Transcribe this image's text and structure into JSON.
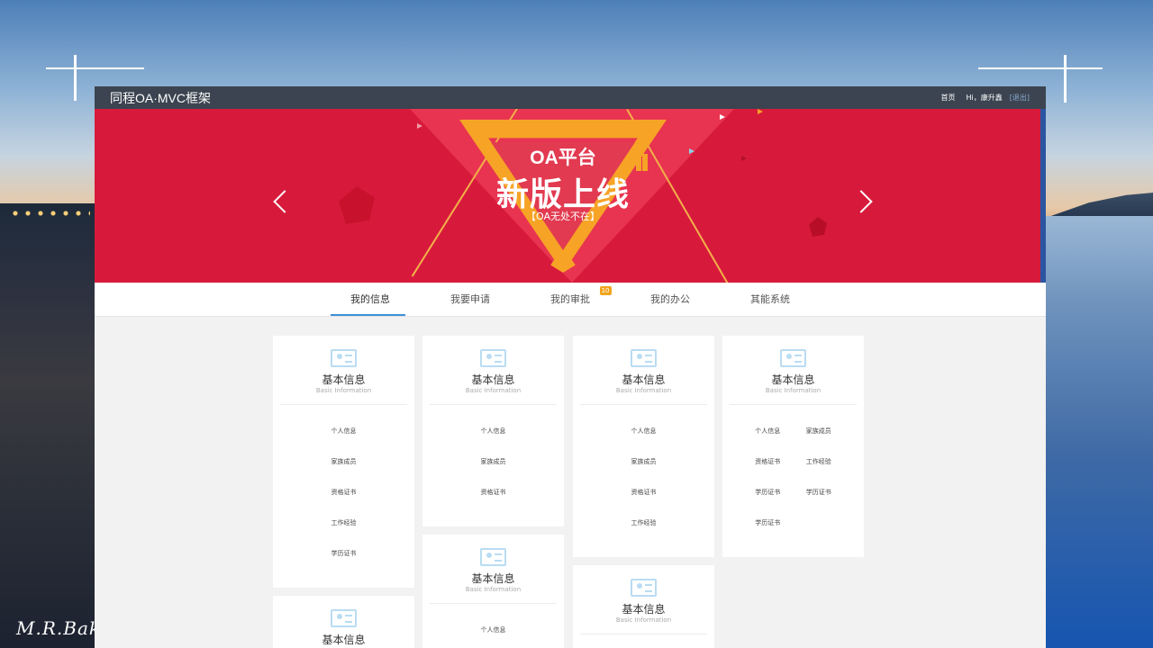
{
  "app": {
    "title": "同程OA·MVC框架"
  },
  "topbar": {
    "home": "首页",
    "greeting": "Hi，康升鑫",
    "logout": "[退出]"
  },
  "banner": {
    "line1": "OA平台",
    "line2": "新版上线",
    "line3": "【OA无处不在】",
    "slides": 3,
    "active_slide": 1
  },
  "tabs": [
    {
      "label": "我的信息",
      "active": true
    },
    {
      "label": "我要申请"
    },
    {
      "label": "我的审批",
      "badge": "10"
    },
    {
      "label": "我的办公"
    },
    {
      "label": "其能系统"
    }
  ],
  "cards": [
    {
      "title": "基本信息",
      "subtitle": "Basic Information",
      "links": [
        "个人信息",
        "家族成员",
        "资格证书",
        "工作经验",
        "学历证书"
      ]
    },
    {
      "title": "基本信息",
      "subtitle": "Basic Information",
      "links": [
        "个人信息",
        "家族成员",
        "资格证书"
      ]
    },
    {
      "title": "基本信息",
      "subtitle": "Basic Information",
      "links": [
        "个人信息",
        "家族成员",
        "资格证书",
        "工作经验"
      ]
    },
    {
      "title": "基本信息",
      "subtitle": "Basic Information",
      "links": [
        "个人信息",
        "家族成员",
        "资格证书",
        "工作经验",
        "学历证书",
        "学历证书",
        "学历证书"
      ]
    },
    {
      "title": "基本信息",
      "subtitle": "Basic Information",
      "links": [
        "个人信息"
      ]
    },
    {
      "title": "基本信息",
      "subtitle": "Basic Information",
      "links": []
    },
    {
      "title": "基本信息",
      "subtitle": "",
      "links": []
    }
  ],
  "signature": "M.R.Bak",
  "colors": {
    "topbar": "#3b4450",
    "banner_red": "#d71a3b",
    "accent_orange": "#f6a326",
    "tab_active": "#3e8fd6",
    "badge": "#f0a51e"
  }
}
